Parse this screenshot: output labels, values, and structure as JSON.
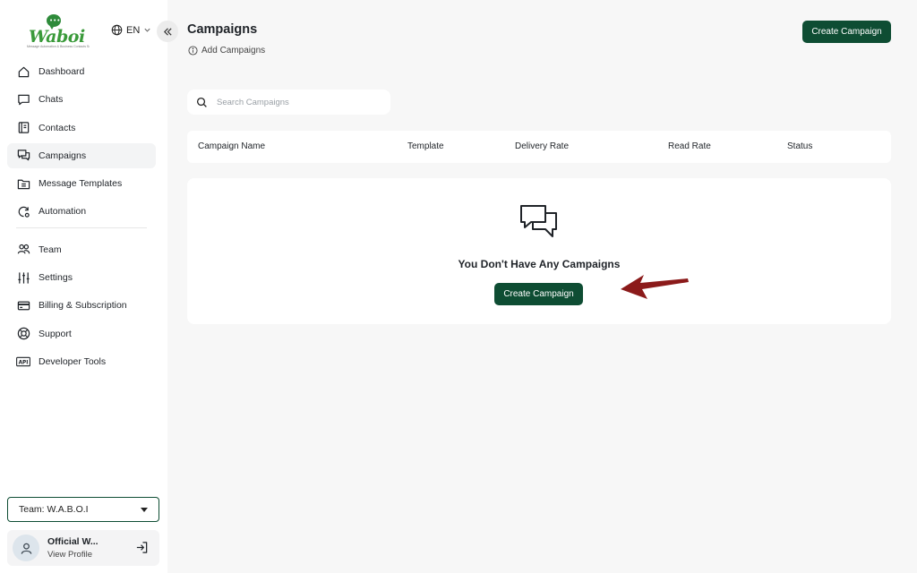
{
  "sidebar": {
    "logo": {
      "brand": "Waboi",
      "tagline": "Message Automation & Business Contacts Solution"
    },
    "language": "EN",
    "items": [
      {
        "label": "Dashboard",
        "icon": "home-icon"
      },
      {
        "label": "Chats",
        "icon": "chat-icon"
      },
      {
        "label": "Contacts",
        "icon": "contacts-icon"
      },
      {
        "label": "Campaigns",
        "icon": "campaigns-icon",
        "active": true
      },
      {
        "label": "Message Templates",
        "icon": "template-icon"
      },
      {
        "label": "Automation",
        "icon": "automation-icon"
      },
      {
        "label": "Team",
        "icon": "team-icon"
      },
      {
        "label": "Settings",
        "icon": "sliders-icon"
      },
      {
        "label": "Billing & Subscription",
        "icon": "card-icon"
      },
      {
        "label": "Support",
        "icon": "lifebuoy-icon"
      },
      {
        "label": "Developer Tools",
        "icon": "api-icon"
      }
    ],
    "team_select": "Team: W.A.B.O.I",
    "profile": {
      "name": "Official W...",
      "sub": "View Profile"
    }
  },
  "header": {
    "title": "Campaigns",
    "add_link": "Add Campaigns",
    "create_label": "Create Campaign"
  },
  "search": {
    "placeholder": "Search Campaigns"
  },
  "table": {
    "columns": [
      "Campaign Name",
      "Template",
      "Delivery Rate",
      "Read Rate",
      "Status"
    ]
  },
  "empty_state": {
    "message": "You Don't Have Any Campaigns",
    "create_label": "Create Campaign"
  },
  "colors": {
    "primary": "#0e4d33",
    "arrow": "#8b1a1a",
    "background": "#f7f7f7"
  }
}
